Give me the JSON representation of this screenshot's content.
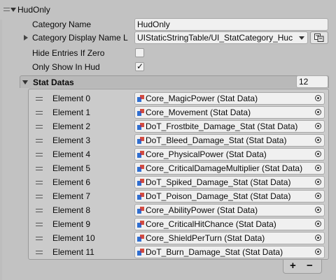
{
  "header": {
    "title": "HudOnly"
  },
  "fields": {
    "category_name_label": "Category Name",
    "category_name_value": "HudOnly",
    "category_display_name_label": "Category Display Name L",
    "category_display_name_value": "UIStaticStringTable/UI_StatCategory_Huc",
    "hide_entries_label": "Hide Entries If Zero",
    "hide_entries_checked": false,
    "only_show_hud_label": "Only Show In Hud",
    "only_show_hud_checked": true
  },
  "stat_datas": {
    "label": "Stat Datas",
    "count": "12",
    "elements": [
      {
        "label": "Element 0",
        "value": "Core_MagicPower (Stat Data)"
      },
      {
        "label": "Element 1",
        "value": "Core_Movement (Stat Data)"
      },
      {
        "label": "Element 2",
        "value": "DoT_Frostbite_Damage_Stat (Stat Data)"
      },
      {
        "label": "Element 3",
        "value": "DoT_Bleed_Damage_Stat (Stat Data)"
      },
      {
        "label": "Element 4",
        "value": "Core_PhysicalPower (Stat Data)"
      },
      {
        "label": "Element 5",
        "value": "Core_CriticalDamageMultiplier (Stat Data)"
      },
      {
        "label": "Element 6",
        "value": "DoT_Spiked_Damage_Stat (Stat Data)"
      },
      {
        "label": "Element 7",
        "value": "DoT_Poison_Damage_Stat (Stat Data)"
      },
      {
        "label": "Element 8",
        "value": "Core_AbilityPower (Stat Data)"
      },
      {
        "label": "Element 9",
        "value": "Core_CriticalHitChance (Stat Data)"
      },
      {
        "label": "Element 10",
        "value": "Core_ShieldPerTurn (Stat Data)"
      },
      {
        "label": "Element 11",
        "value": "DoT_Burn_Damage_Stat (Stat Data)"
      }
    ],
    "add_label": "+",
    "remove_label": "−"
  },
  "icons": {
    "foldout_open": "triangle-down-icon",
    "foldout_closed": "triangle-right-icon",
    "checkmark": "✓",
    "scriptable_object": "scriptable-object-icon",
    "object_picker": "object-picker-icon",
    "dropdown": "chevron-down-icon",
    "localize": "localize-icon"
  },
  "colors": {
    "background": "#c2c2c2",
    "field_bg": "#f0f0f0",
    "list_bg": "#cbcbcb",
    "header_bg": "#b9b9b9",
    "so_icon_blue": "#2f6fd1",
    "so_icon_red": "#d03a2b"
  }
}
